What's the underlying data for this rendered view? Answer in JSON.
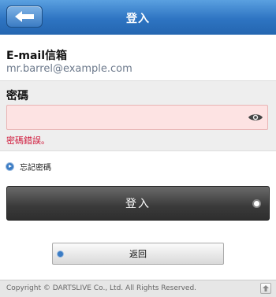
{
  "header": {
    "title": "登入",
    "back_icon": "left-arrow-icon"
  },
  "email": {
    "label": "E-mail信箱",
    "value": "mr.barrel@example.com"
  },
  "password": {
    "label": "密碼",
    "value": "",
    "toggle_icon": "eye-icon",
    "error": "密碼錯誤。"
  },
  "forgot": {
    "label": "忘記密碼"
  },
  "login_button": {
    "label": "登入"
  },
  "back_button": {
    "label": "返回"
  },
  "footer": {
    "copyright": "Copyright © DARTSLIVE Co., Ltd. All Rights Reserved.",
    "top_icon": "arrow-up-icon"
  },
  "colors": {
    "header_blue": "#2e74c2",
    "error_red": "#d0183a",
    "input_error_bg": "#fde3e3",
    "login_button": "#3a3a3a"
  }
}
